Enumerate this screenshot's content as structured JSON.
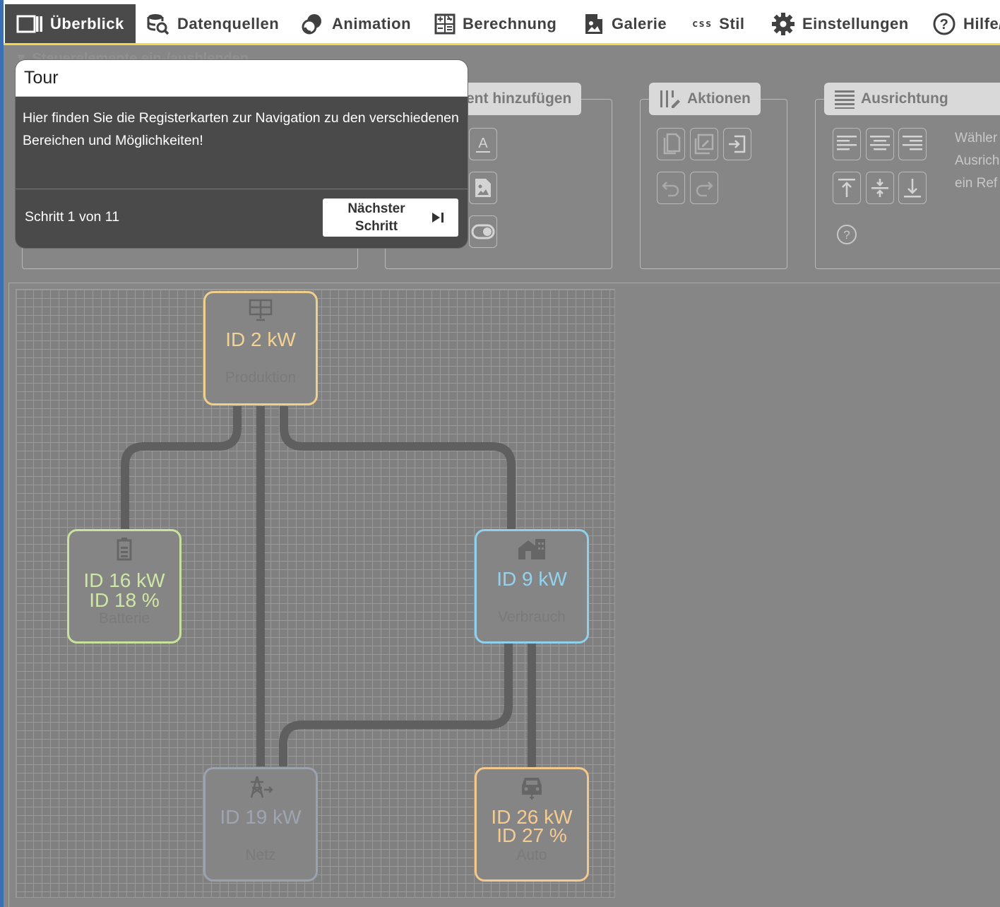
{
  "tabs": [
    {
      "label": "Überblick",
      "icon": "overview-icon",
      "active": true
    },
    {
      "label": "Datenquellen",
      "icon": "database-search-icon"
    },
    {
      "label": "Animation",
      "icon": "animation-icon"
    },
    {
      "label": "Berechnung",
      "icon": "calculator-icon"
    },
    {
      "label": "Galerie",
      "icon": "gallery-icon"
    },
    {
      "label": "Stil",
      "icon": "css-icon",
      "icon_text": "css"
    },
    {
      "label": "Einstellungen",
      "icon": "gear-icon"
    },
    {
      "label": "Hilfe/",
      "icon": "help-circle-icon"
    }
  ],
  "toolbar": {
    "toggle_label": "Steuerelemente ein-/ausblenden",
    "add_element_title": "ent hinzufügen",
    "actions_title": "Aktionen",
    "alignment_title": "Ausrichtung",
    "alignment_hint": [
      "Wähler",
      "Ausrich",
      "ein Ref"
    ]
  },
  "tour": {
    "title": "Tour",
    "body": "Hier finden Sie die Registerkarten zur Navigation zu den verschiedenen Bereichen und Möglichkeiten!",
    "step": "Schritt 1 von 11",
    "next_line1": "Nächster",
    "next_line2": "Schritt"
  },
  "nodes": {
    "production": {
      "value": "ID 2 kW",
      "label": "Produktion",
      "icon": "solar-panel-icon",
      "color": "#f0cf8a"
    },
    "battery": {
      "value": "ID 16 kW",
      "value2": "ID 18 %",
      "label": "Batterie",
      "icon": "battery-icon",
      "color": "#c8e29b"
    },
    "consumption": {
      "value": "ID 9 kW",
      "label": "Verbrauch",
      "icon": "house-icon",
      "color": "#8fd0ec"
    },
    "grid": {
      "value": "ID 19 kW",
      "label": "Netz",
      "icon": "power-grid-icon",
      "color": "#9aa2ae"
    },
    "car": {
      "value": "ID 26 kW",
      "value2": "ID 27 %",
      "label": "Auto",
      "icon": "car-icon",
      "color": "#f2c88c"
    }
  },
  "colors": {
    "accent": "#f3d94a",
    "dim": "#868686",
    "active_tab": "#4a4a4a",
    "line": "#5f5f5f"
  }
}
